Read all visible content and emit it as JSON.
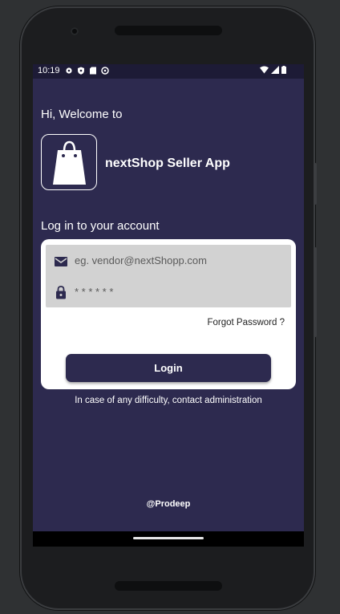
{
  "statusbar": {
    "time": "10:19",
    "left_icons": [
      "gear-icon",
      "shield-icon",
      "sd-card-icon",
      "settings-icon"
    ],
    "right_icons": [
      "wifi-icon",
      "signal-icon",
      "battery-icon"
    ]
  },
  "header": {
    "greeting": "Hi, Welcome to",
    "app_name": "nextShop Seller App"
  },
  "login": {
    "heading": "Log in to your account",
    "email_placeholder": "eg. vendor@nextShopp.com",
    "password_placeholder": "* * * * * *",
    "forgot_label": "Forgot Password ?",
    "button_label": "Login"
  },
  "footer": {
    "help_text": "In case of any difficulty, contact administration",
    "credit": "@Prodeep"
  },
  "colors": {
    "screen_bg": "#2d2a4f",
    "statusbar_bg": "#1d1b36",
    "card_bg": "#ffffff",
    "field_bg": "#d2d2d2",
    "button_bg": "#2d2a4f"
  }
}
